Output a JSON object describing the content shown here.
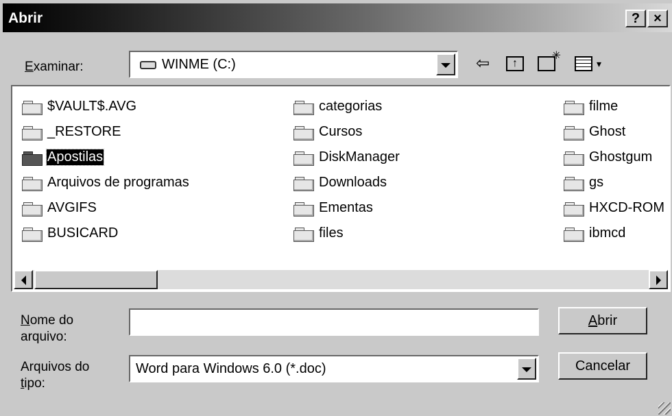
{
  "window": {
    "title": "Abrir",
    "help_label": "?",
    "close_label": "×"
  },
  "look_in": {
    "label": "Examinar:",
    "accesskey": "E",
    "label_rest": "xaminar:",
    "value": "WINME (C:)"
  },
  "toolbar": {
    "back_icon": "back-arrow-icon",
    "up_icon": "up-folder-icon",
    "new_folder_icon": "new-folder-icon",
    "view_menu_icon": "view-menu-icon"
  },
  "files": {
    "col1": [
      "$VAULT$.AVG",
      "_RESTORE",
      "Apostilas",
      "Arquivos de programas",
      "AVGIFS",
      "BUSICARD"
    ],
    "col2": [
      "categorias",
      "Cursos",
      "DiskManager",
      "Downloads",
      "Ementas",
      "files"
    ],
    "col3": [
      "filme",
      "Ghost",
      "Ghostgum",
      "gs",
      "HXCD-ROM",
      "ibmcd"
    ],
    "selected": "Apostilas"
  },
  "filename": {
    "label_line1_key": "N",
    "label_line1_rest": "ome do",
    "label_line2": "arquivo:",
    "value": ""
  },
  "filetype": {
    "label_line1": "Arquivos do",
    "label_line2_key": "t",
    "label_line2_rest": "ipo:",
    "value": "Word para Windows 6.0 (*.doc)"
  },
  "buttons": {
    "open_key": "A",
    "open_rest": "brir",
    "cancel": "Cancelar"
  }
}
